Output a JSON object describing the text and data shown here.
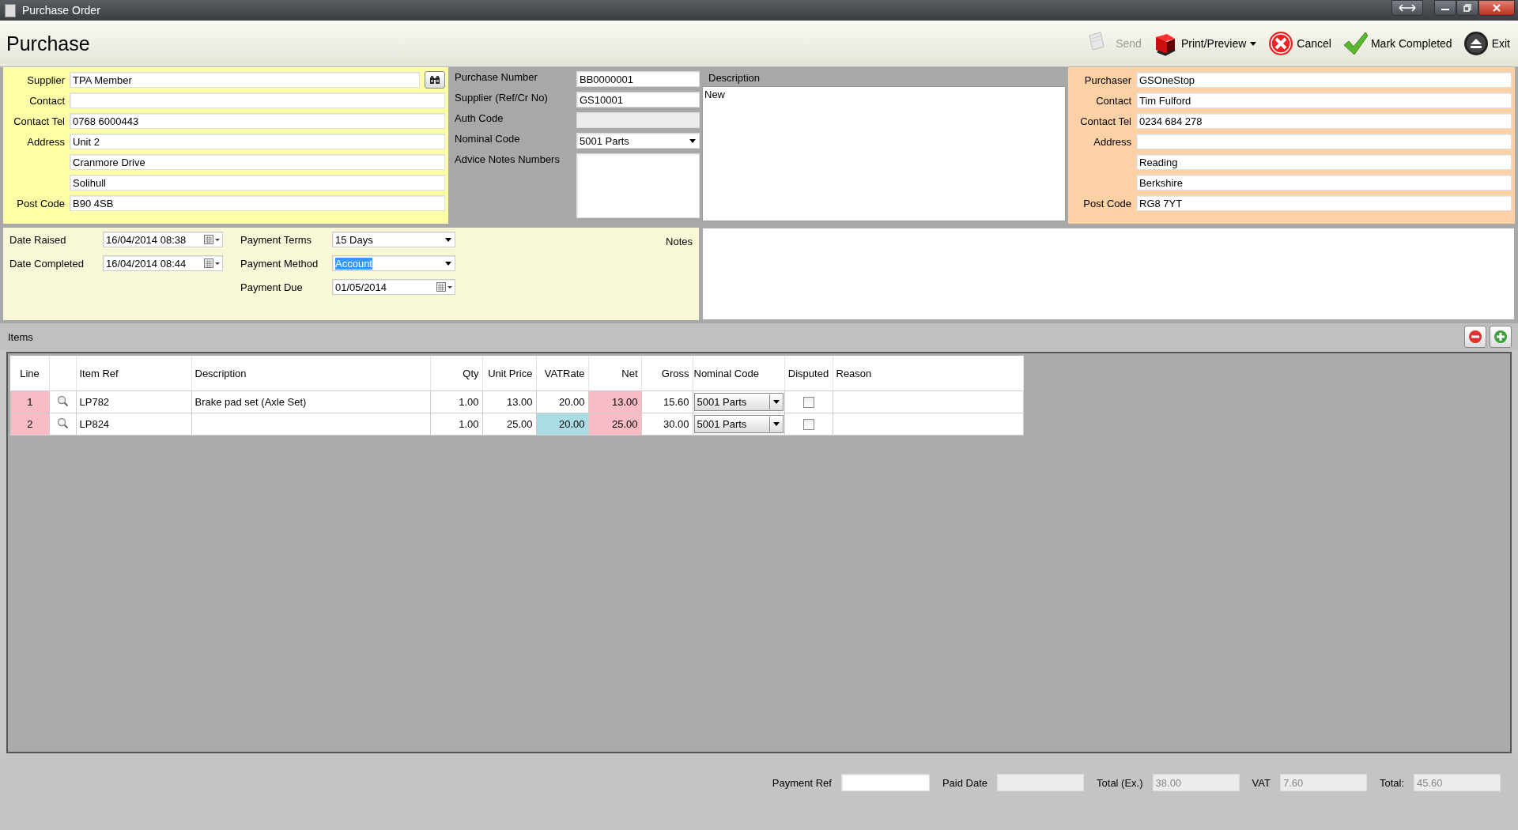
{
  "window": {
    "title": "Purchase Order"
  },
  "header": {
    "title": "Purchase",
    "actions": [
      {
        "label": "Send",
        "kind": "send",
        "disabled": true,
        "has_menu": false
      },
      {
        "label": "Print/Preview",
        "kind": "print",
        "disabled": false,
        "has_menu": true
      },
      {
        "label": "Cancel",
        "kind": "cancel",
        "disabled": false,
        "has_menu": false
      },
      {
        "label": "Mark Completed",
        "kind": "complete",
        "disabled": false,
        "has_menu": false
      },
      {
        "label": "Exit",
        "kind": "exit",
        "disabled": false,
        "has_menu": false
      }
    ]
  },
  "supplier": {
    "fields": [
      {
        "label": "Supplier",
        "value": "TPA Member",
        "lookup": true
      },
      {
        "label": "Contact",
        "lookup": false
      },
      {
        "label": "Contact Tel",
        "value": "0768 6000443",
        "lookup": false
      },
      {
        "label": "Address",
        "value": "Unit 2",
        "lookup": false
      },
      {
        "value": "Cranmore Drive",
        "lookup": false
      },
      {
        "value": "Solihull",
        "lookup": false
      },
      {
        "label": "Post Code",
        "value": "B90 4SB",
        "lookup": false
      }
    ]
  },
  "order": {
    "fields": [
      {
        "label": "Purchase Number",
        "value": "BB0000001",
        "kind": "text",
        "disabled": false
      },
      {
        "label": "Supplier (Ref/Cr No)",
        "value": "GS10001",
        "kind": "text",
        "disabled": false
      },
      {
        "label": "Auth Code",
        "kind": "text",
        "disabled": true
      },
      {
        "label": "Nominal Code",
        "value": "5001 Parts",
        "kind": "combo",
        "disabled": false
      },
      {
        "label": "Advice Notes Numbers",
        "kind": "memo",
        "disabled": false
      }
    ]
  },
  "description": {
    "label": "Description",
    "value": "New"
  },
  "purchaser": {
    "fields": [
      {
        "label": "Purchaser",
        "value": "GSOneStop"
      },
      {
        "label": "Contact",
        "value": "Tim Fulford"
      },
      {
        "label": "Contact Tel",
        "value": "0234 684 278"
      },
      {
        "label": "Address"
      },
      {
        "value": "Reading"
      },
      {
        "value": "Berkshire"
      },
      {
        "label": "Post Code",
        "value": "RG8 7YT"
      }
    ]
  },
  "dates": [
    {
      "label": "Date Raised",
      "value": "16/04/2014 08:38"
    },
    {
      "label": "Date Completed",
      "value": "16/04/2014 08:44"
    }
  ],
  "payment": [
    {
      "label": "Payment Terms",
      "value": "15 Days",
      "kind": "combo",
      "highlighted": false
    },
    {
      "label": "Payment Method",
      "value": "Account",
      "kind": "combo",
      "highlighted": true
    },
    {
      "label": "Payment Due",
      "value": "01/05/2014",
      "kind": "date",
      "highlighted": false
    }
  ],
  "notes": {
    "label": "Notes"
  },
  "items": {
    "title": "Items",
    "columns": [
      {
        "label": "Line",
        "kind": "center"
      },
      {
        "kind": "lookup"
      },
      {
        "label": "Item Ref",
        "kind": "text"
      },
      {
        "label": "Description",
        "kind": "text"
      },
      {
        "label": "Qty",
        "kind": "num"
      },
      {
        "label": "Unit Price",
        "kind": "num"
      },
      {
        "label": "VATRate",
        "kind": "num"
      },
      {
        "label": "Net",
        "kind": "num"
      },
      {
        "label": "Gross",
        "kind": "num"
      },
      {
        "label": "Nominal Code",
        "kind": "combo"
      },
      {
        "label": "Disputed",
        "kind": "check"
      },
      {
        "label": "Reason",
        "kind": "text"
      }
    ],
    "rows": [
      [
        {
          "text": "1",
          "color": "#f7bcc6"
        },
        {},
        {
          "text": "LP782"
        },
        {
          "text": "Brake pad set (Axle Set)"
        },
        {
          "text": "1.00"
        },
        {
          "text": "13.00"
        },
        {
          "text": "20.00"
        },
        {
          "text": "13.00",
          "color": "#f7bcc6"
        },
        {
          "text": "15.60"
        },
        {
          "text": "5001 Parts"
        },
        {
          "checked": false
        },
        {}
      ],
      [
        {
          "text": "2",
          "color": "#f7bcc6"
        },
        {},
        {
          "text": "LP824"
        },
        {},
        {
          "text": "1.00"
        },
        {
          "text": "25.00"
        },
        {
          "text": "20.00",
          "color": "#a9dde3"
        },
        {
          "text": "25.00",
          "color": "#f7bcc6"
        },
        {
          "text": "30.00"
        },
        {
          "text": "5001 Parts"
        },
        {
          "checked": false
        },
        {}
      ]
    ]
  },
  "footer": [
    {
      "label": "Payment Ref",
      "disabled": false
    },
    {
      "label": "Paid Date",
      "disabled": true
    },
    {
      "label": "Total (Ex.)",
      "value": "38.00",
      "disabled": true
    },
    {
      "label": "VAT",
      "value": "7.60",
      "disabled": true
    },
    {
      "label": "Total:",
      "value": "45.60",
      "disabled": true
    }
  ]
}
